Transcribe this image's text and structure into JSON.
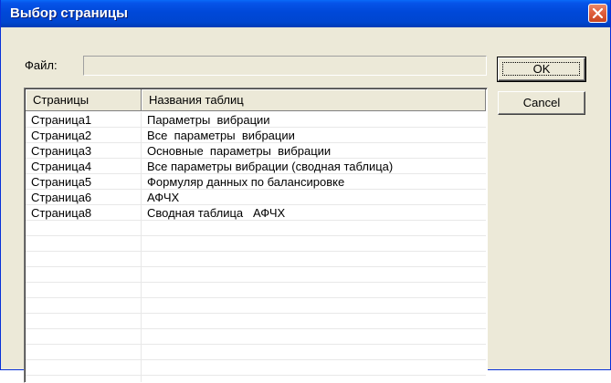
{
  "window": {
    "title": "Выбор страницы"
  },
  "file": {
    "label": "Файл:",
    "value": ""
  },
  "list": {
    "columns": [
      "Страницы",
      "Названия таблиц"
    ],
    "rows": [
      [
        "Страница1",
        "Параметры  вибрации"
      ],
      [
        "Страница2",
        "Все  параметры  вибрации"
      ],
      [
        "Страница3",
        "Основные  параметры  вибрации"
      ],
      [
        "Страница4",
        "Все параметры вибрации (сводная таблица)"
      ],
      [
        "Страница5",
        "Формуляр данных по балансировке"
      ],
      [
        "Страница6",
        "АФЧХ"
      ],
      [
        "Страница8",
        "Сводная таблица   АФЧХ"
      ]
    ]
  },
  "buttons": {
    "ok": "OK",
    "cancel": "Cancel"
  },
  "colors": {
    "titlebar": "#0046d0",
    "close": "#e0603e",
    "face": "#ece9d8"
  }
}
